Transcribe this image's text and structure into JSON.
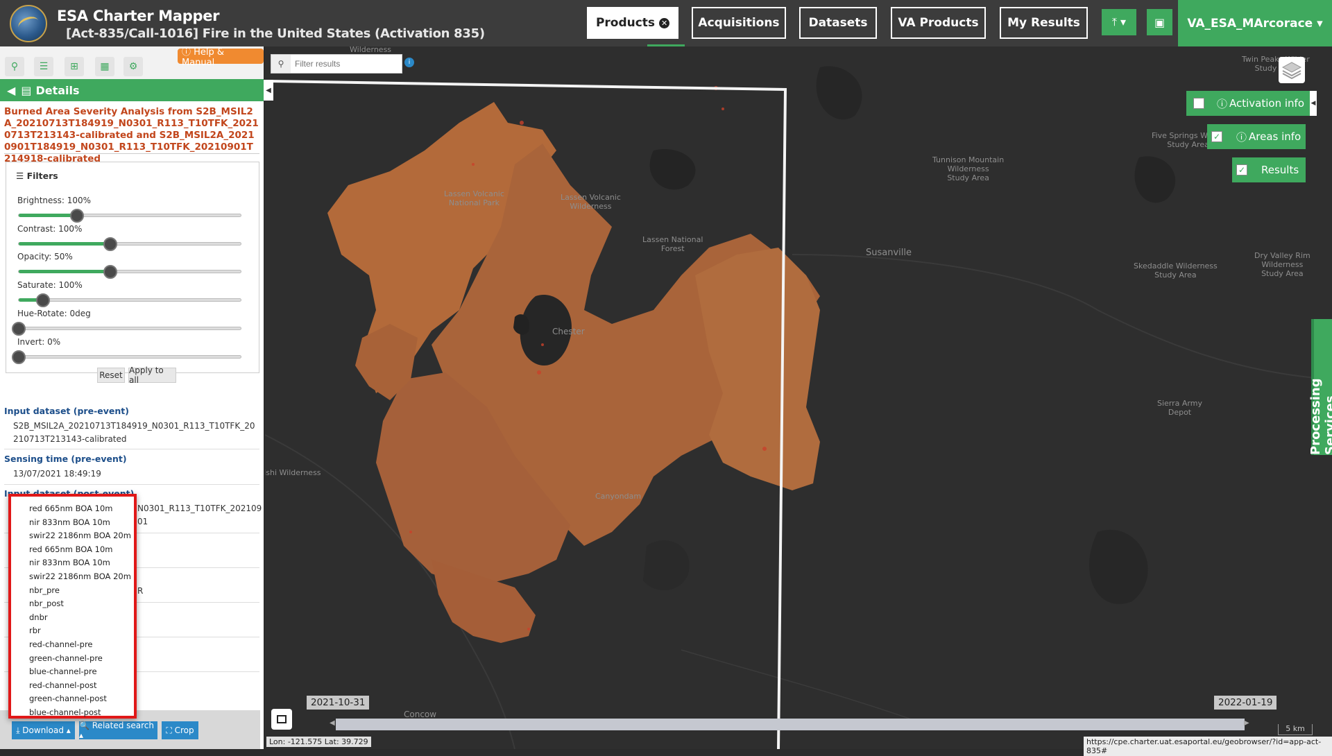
{
  "header": {
    "app_title": "ESA Charter Mapper",
    "activation_title": "[Act-835/Call-1016] Fire in the United States (Activation 835)",
    "nav": [
      {
        "label": "Products",
        "active": true
      },
      {
        "label": "Acquisitions"
      },
      {
        "label": "Datasets"
      },
      {
        "label": "VA Products"
      },
      {
        "label": "My Results"
      }
    ],
    "user": "VA_ESA_MArcorace ▾",
    "upload_icon": "upload-icon",
    "briefcase_icon": "briefcase-icon"
  },
  "left_panel": {
    "help_label": "ⓘ Help & Manual",
    "details_label": "Details",
    "product_title": "Burned Area Severity Analysis from S2B_MSIL2A_20210713T184919_N0301_R113_T10TFK_20210713T213143-calibrated and S2B_MSIL2A_20210901T184919_N0301_R113_T10TFK_20210901T214918-calibrated",
    "filters": {
      "heading": "Filters",
      "items": [
        {
          "label": "Brightness: 100%",
          "value": 0.26
        },
        {
          "label": "Contrast: 100%",
          "value": 0.41
        },
        {
          "label": "Opacity: 50%",
          "value": 0.41
        },
        {
          "label": "Saturate: 100%",
          "value": 0.11
        },
        {
          "label": "Hue-Rotate: 0deg",
          "value": 0.0
        },
        {
          "label": "Invert: 0%",
          "value": 0.0
        }
      ],
      "reset_label": "Reset",
      "apply_label": "Apply to all"
    },
    "sections": {
      "input_pre_label": "Input dataset (pre-event)",
      "input_pre_value": "S2B_MSIL2A_20210713T184919_N0301_R113_T10TFK_20210713T213143-calibrated",
      "sensing_pre_label": "Sensing time (pre-event)",
      "sensing_pre_value": "13/07/2021 18:49:19",
      "input_post_label": "Input dataset (post-event)",
      "input_post_partial": "N0301_R113_T10TFK_20210901",
      "row_partial": "R"
    },
    "bottom": {
      "download_label": "⤓ Download ▴",
      "related_label": "🔍 Related search ▴",
      "crop_label": "⛶ Crop"
    },
    "download_menu": [
      "red 665nm BOA 10m",
      "nir 833nm BOA 10m",
      "swir22 2186nm BOA 20m",
      "red 665nm BOA 10m",
      "nir 833nm BOA 10m",
      "swir22 2186nm BOA 20m",
      "nbr_pre",
      "nbr_post",
      "dnbr",
      "rbr",
      "red-channel-pre",
      "green-channel-pre",
      "blue-channel-pre",
      "red-channel-post",
      "green-channel-post",
      "blue-channel-post"
    ]
  },
  "map": {
    "search_placeholder": "Filter results",
    "activation_info": "Activation info",
    "areas_info": "Areas info",
    "results": "Results",
    "processing_services": "Processing Services",
    "date_start": "2021-10-31",
    "date_end": "2022-01-19",
    "coords": "Lon: -121.575 Lat: 39.729",
    "url": "https://cpe.charter.uat.esaportal.eu/geobrowser/?id=app-act-835#",
    "scale": "5 km",
    "labels": {
      "wilderness_top": "Wilderness",
      "twin_peaks": "Twin Peaks Wilder\nStudy Area",
      "five_springs": "Five Springs Wilder\nStudy Area",
      "tunnison": "Tunnison Mountain\nWilderness\nStudy Area",
      "lassen_park": "Lassen Volcanic\nNational Park",
      "lassen_wild": "Lassen Volcanic\nWilderness",
      "lassen_forest": "Lassen National\nForest",
      "susanville": "Susanville",
      "skedaddle": "Skedaddle Wilderness\nStudy Area",
      "dry_valley": "Dry Valley Rim\nWilderness\nStudy Area",
      "chester": "Chester",
      "sierra_army": "Sierra Army\nDepot",
      "ishi": "Ishi Wilderness",
      "canyondam": "Canyondam",
      "concow": "Concow"
    }
  }
}
